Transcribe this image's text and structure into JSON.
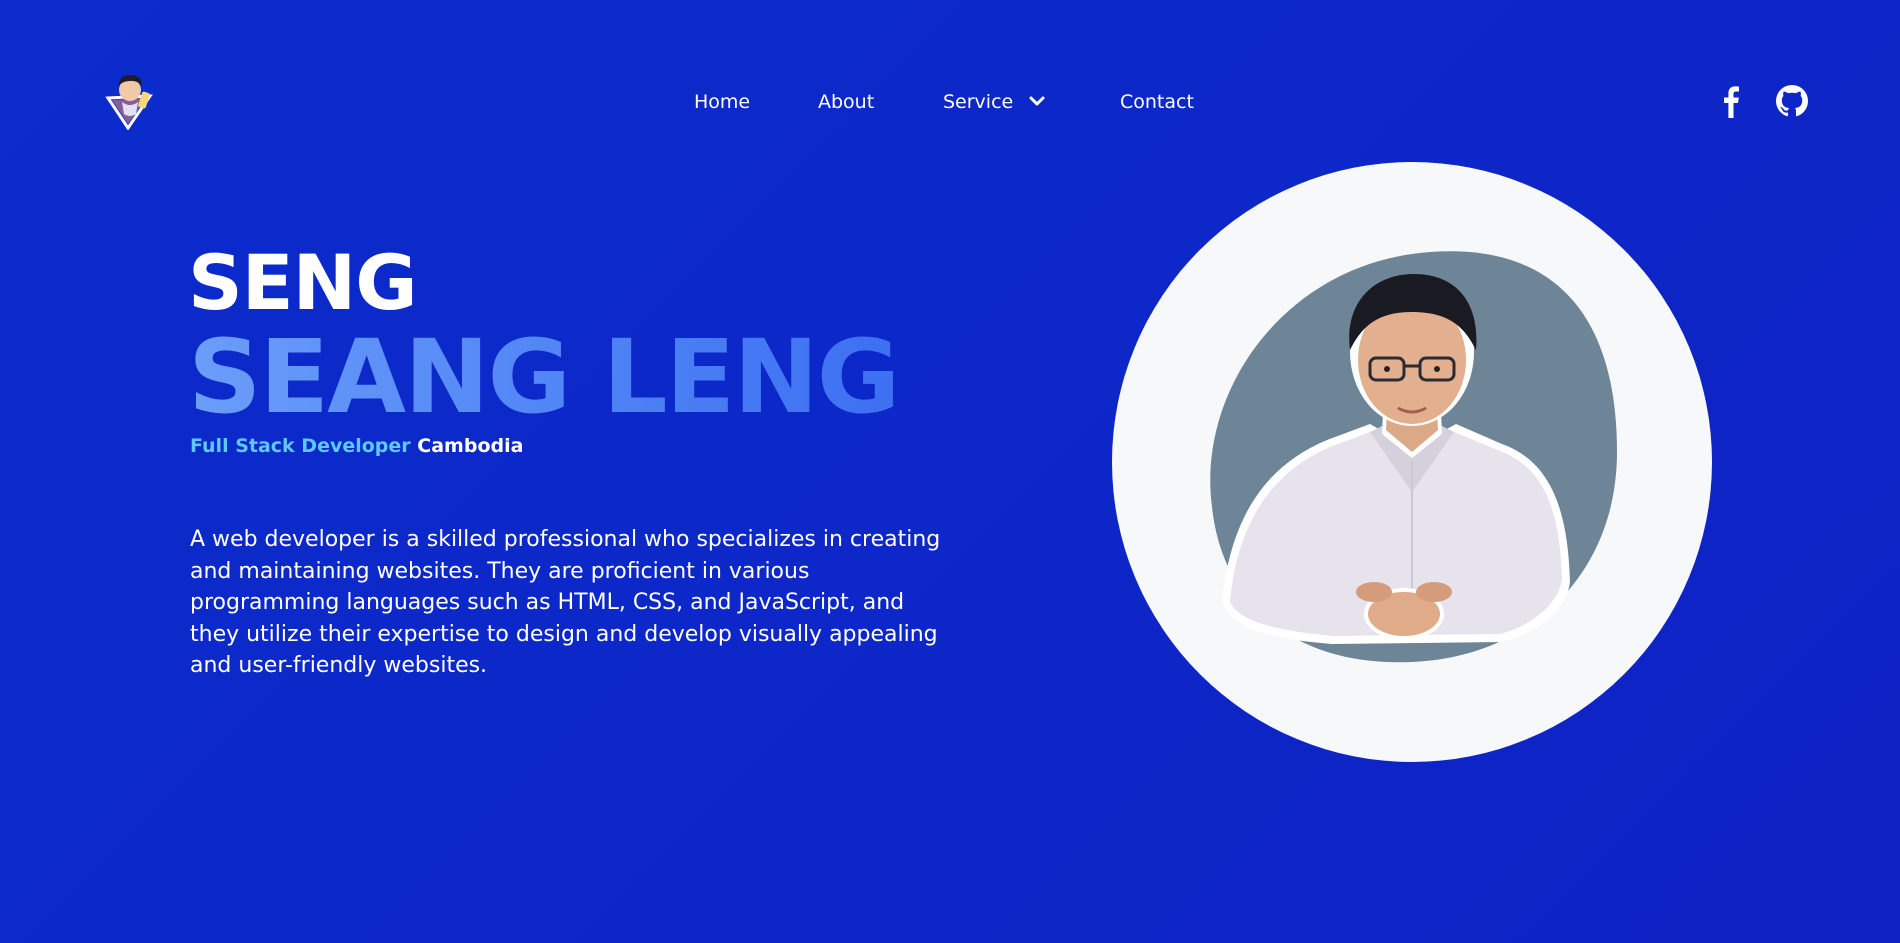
{
  "header": {
    "logo_icon": "avatar-logo-icon",
    "nav": [
      {
        "label": "Home"
      },
      {
        "label": "About"
      },
      {
        "label": "Service",
        "icon": "chevron-down-icon"
      },
      {
        "label": "Contact"
      }
    ],
    "social": [
      {
        "icon": "facebook-icon"
      },
      {
        "icon": "github-icon"
      }
    ]
  },
  "hero": {
    "first_name": "SENG",
    "last_name": "SEANG LENG",
    "role": "Full Stack Developer",
    "location": "Cambodia",
    "description": "A web developer is a skilled professional who specializes in creating and maintaining websites. They are proficient in various programming languages such as HTML, CSS, and JavaScript, and they utilize their expertise to design and develop visually appealing and user-friendly websites.",
    "photo_icon": "profile-photo"
  },
  "colors": {
    "background": "#0d28c8",
    "accent_light": "#5ec8fb",
    "name_gradient_start": "#6b9dfa",
    "name_gradient_end": "#3d6ff2",
    "photo_ring": "#f7f8fa",
    "photo_blob": "#6d8597"
  }
}
